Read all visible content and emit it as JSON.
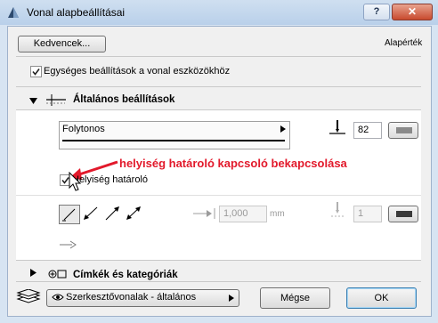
{
  "window": {
    "title": "Vonal alapbeállításai",
    "help": "?",
    "close": "✕"
  },
  "toolbar": {
    "favorites_label": "Kedvencek...",
    "defaults_label": "Alapérték"
  },
  "uniform_settings": {
    "label": "Egységes beállítások a vonal eszközökhöz",
    "checked": true
  },
  "general_section": {
    "title": "Általános beállítások",
    "line_type": "Folytonos",
    "pen_number": "82",
    "zone_boundary": {
      "label": "Helyiség határoló",
      "checked": true
    },
    "spacing_value": "1,000",
    "spacing_unit": "mm",
    "count_value": "1"
  },
  "annotation": {
    "text": "helyiség határoló kapcsoló bekapcsolása",
    "color": "#e2192b"
  },
  "labels_section": {
    "title": "Címkék és kategóriák"
  },
  "footer": {
    "layer_label": "Szerkesztővonalak - általános",
    "cancel_label": "Mégse",
    "ok_label": "OK"
  }
}
